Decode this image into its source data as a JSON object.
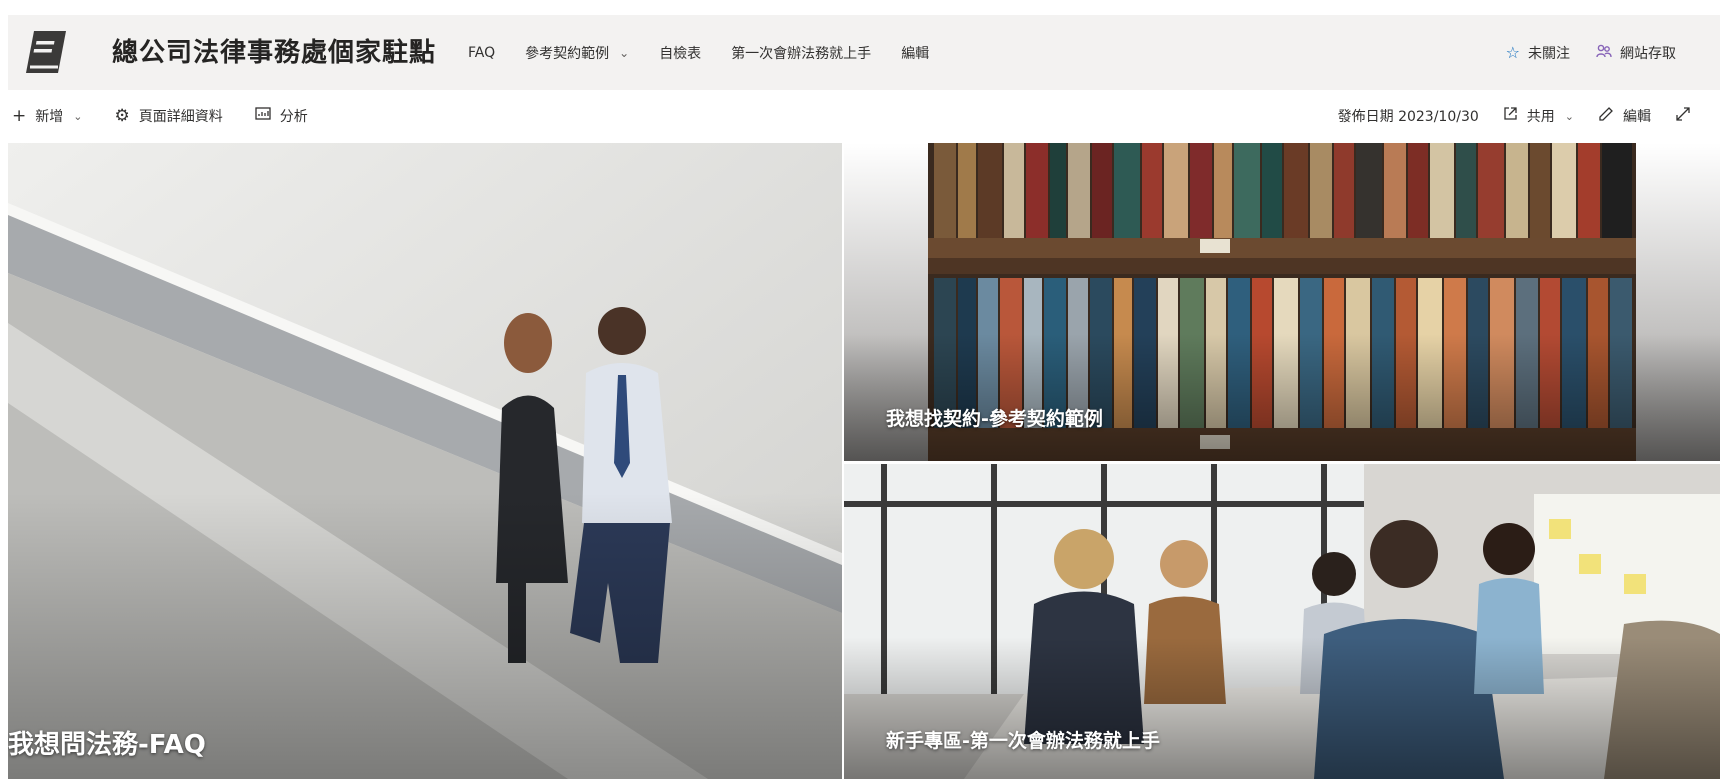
{
  "site": {
    "title": "總公司法律事務處個家駐點",
    "logo_icon": "notebook-icon",
    "nav": [
      {
        "label": "FAQ"
      },
      {
        "label": "參考契約範例",
        "has_dropdown": true
      },
      {
        "label": "自檢表"
      },
      {
        "label": "第一次會辦法務就上手"
      },
      {
        "label": "編輯"
      }
    ],
    "actions": {
      "follow_label": "未關注",
      "follow_icon": "star-icon",
      "site_access_label": "網站存取",
      "site_access_icon": "people-icon"
    }
  },
  "command_bar": {
    "new_label": "新增",
    "page_details_label": "頁面詳細資料",
    "analytics_label": "分析",
    "published": "發佈日期 2023/10/30",
    "share_label": "共用",
    "edit_label": "編輯"
  },
  "hero": {
    "tiles": [
      {
        "caption": "我想問法務-FAQ"
      },
      {
        "caption": "我想找契約-參考契約範例"
      },
      {
        "caption": "新手專區-第一次會辦法務就上手"
      }
    ]
  },
  "colors": {
    "header_bg": "#f3f2f1",
    "accent": "#0f6cbd",
    "logo": "#3b3a39"
  }
}
